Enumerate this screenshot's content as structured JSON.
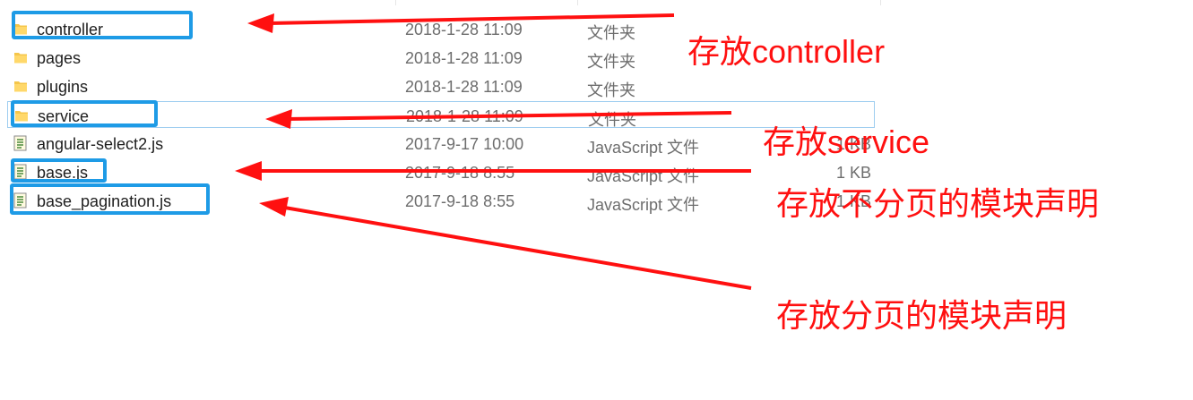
{
  "files": [
    {
      "name": "controller",
      "date": "2018-1-28 11:09",
      "type": "文件夹",
      "size": "",
      "icon": "folder-icon"
    },
    {
      "name": "pages",
      "date": "2018-1-28 11:09",
      "type": "文件夹",
      "size": "",
      "icon": "folder-icon"
    },
    {
      "name": "plugins",
      "date": "2018-1-28 11:09",
      "type": "文件夹",
      "size": "",
      "icon": "folder-icon"
    },
    {
      "name": "service",
      "date": "2018-1-28 11:09",
      "type": "文件夹",
      "size": "",
      "icon": "folder-icon"
    },
    {
      "name": "angular-select2.js",
      "date": "2017-9-17 10:00",
      "type": "JavaScript 文件",
      "size": "1 KB",
      "icon": "js-file-icon"
    },
    {
      "name": "base.js",
      "date": "2017-9-18 8:55",
      "type": "JavaScript 文件",
      "size": "1 KB",
      "icon": "js-file-icon"
    },
    {
      "name": "base_pagination.js",
      "date": "2017-9-18 8:55",
      "type": "JavaScript 文件",
      "size": "1 KB",
      "icon": "js-file-icon"
    }
  ],
  "annotations": {
    "controller": "存放controller",
    "service": "存放service",
    "base": "存放不分页的模块声明",
    "base_pagination": "存放分页的模块声明"
  },
  "colors": {
    "annotation": "#ff1010",
    "highlight_box": "#1e9be6",
    "selection_border": "#9ecdf0",
    "folder": "#f5c64a"
  }
}
